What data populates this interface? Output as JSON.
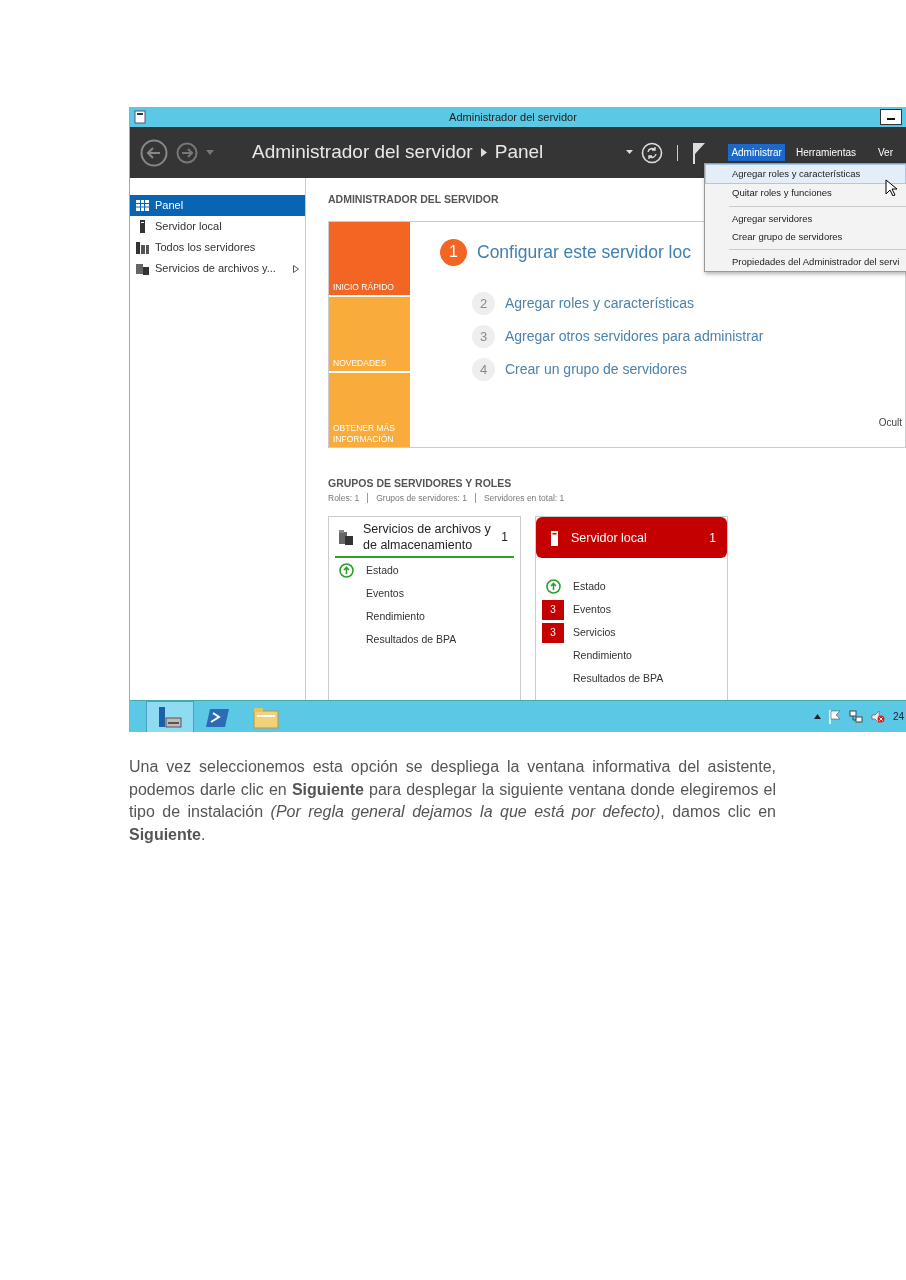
{
  "window": {
    "title": "Administrador del servidor"
  },
  "header": {
    "breadcrumb": [
      "Administrador del servidor",
      "Panel"
    ],
    "menu": [
      {
        "label": "Administrar",
        "selected": true
      },
      {
        "label": "Herramientas",
        "selected": false
      },
      {
        "label": "Ver",
        "selected": false
      }
    ]
  },
  "dropdown": {
    "groups": [
      {
        "items": [
          {
            "label": "Agregar roles y características",
            "selected": true
          },
          {
            "label": "Quitar roles y funciones",
            "selected": false
          }
        ]
      },
      {
        "items": [
          {
            "label": "Agregar servidores",
            "selected": false
          },
          {
            "label": "Crear grupo de servidores",
            "selected": false
          }
        ]
      },
      {
        "items": [
          {
            "label": "Propiedades del Administrador del servi",
            "selected": false
          }
        ]
      }
    ]
  },
  "sidebar": {
    "items": [
      {
        "label": "Panel",
        "kind": "grid",
        "selected": true,
        "expandable": false
      },
      {
        "label": "Servidor local",
        "kind": "server",
        "selected": false,
        "expandable": false
      },
      {
        "label": "Todos los servidores",
        "kind": "servers",
        "selected": false,
        "expandable": false
      },
      {
        "label": "Servicios de archivos y...",
        "kind": "files",
        "selected": false,
        "expandable": true
      }
    ]
  },
  "dashboard": {
    "heading": "ADMINISTRADOR DEL SERVIDOR",
    "tiles": [
      {
        "label": "INICIO RÁPIDO",
        "color": "#f26522"
      },
      {
        "label": "NOVEDADES",
        "color": "#f9ab3c"
      },
      {
        "label": "OBTENER MÁS INFORMACIÓN",
        "color": "#f9ab3c"
      }
    ],
    "steps": [
      {
        "number": "1",
        "label": "Configurar este servidor loc",
        "current": true
      },
      {
        "number": "2",
        "label": "Agregar roles y características",
        "current": false
      },
      {
        "number": "3",
        "label": "Agregar otros servidores para administrar",
        "current": false
      },
      {
        "number": "4",
        "label": "Crear un grupo de servidores",
        "current": false
      }
    ],
    "hide_link": "Ocult"
  },
  "groups": {
    "title": "GRUPOS DE SERVIDORES Y ROLES",
    "summary": [
      "Roles: 1",
      "Grupos de servidores: 1",
      "Servidores en total: 1"
    ],
    "cards": [
      {
        "title": "Servicios de archivos y de almacenamiento",
        "count": "1",
        "kind": "files",
        "alert": false,
        "items": [
          {
            "label": "Estado",
            "kind": "ok"
          },
          {
            "label": "Eventos",
            "kind": "plain"
          },
          {
            "label": "Rendimiento",
            "kind": "plain"
          },
          {
            "label": "Resultados de BPA",
            "kind": "plain"
          }
        ]
      },
      {
        "title": "Servidor local",
        "count": "1",
        "kind": "server",
        "alert": true,
        "items": [
          {
            "label": "Estado",
            "kind": "ok"
          },
          {
            "label": "Eventos",
            "kind": "badge",
            "badge": "3"
          },
          {
            "label": "Servicios",
            "kind": "badge",
            "badge": "3"
          },
          {
            "label": "Rendimiento",
            "kind": "plain"
          },
          {
            "label": "Resultados de BPA",
            "kind": "plain"
          }
        ]
      }
    ]
  },
  "taskbar": {
    "apps": [
      {
        "kind": "server-manager",
        "selected": true
      },
      {
        "kind": "powershell",
        "selected": false
      },
      {
        "kind": "explorer",
        "selected": false
      }
    ],
    "clock": "24"
  },
  "paragraph": "Una vez seleccionemos esta opción se despliega la ventana informativa del asistente, podemos darle clic en **Siguiente** para desplegar la siguiente ventana donde elegiremos el tipo de instalación *(Por regla general dejamos la que está por defecto)*, damos clic en **Siguiente**."
}
